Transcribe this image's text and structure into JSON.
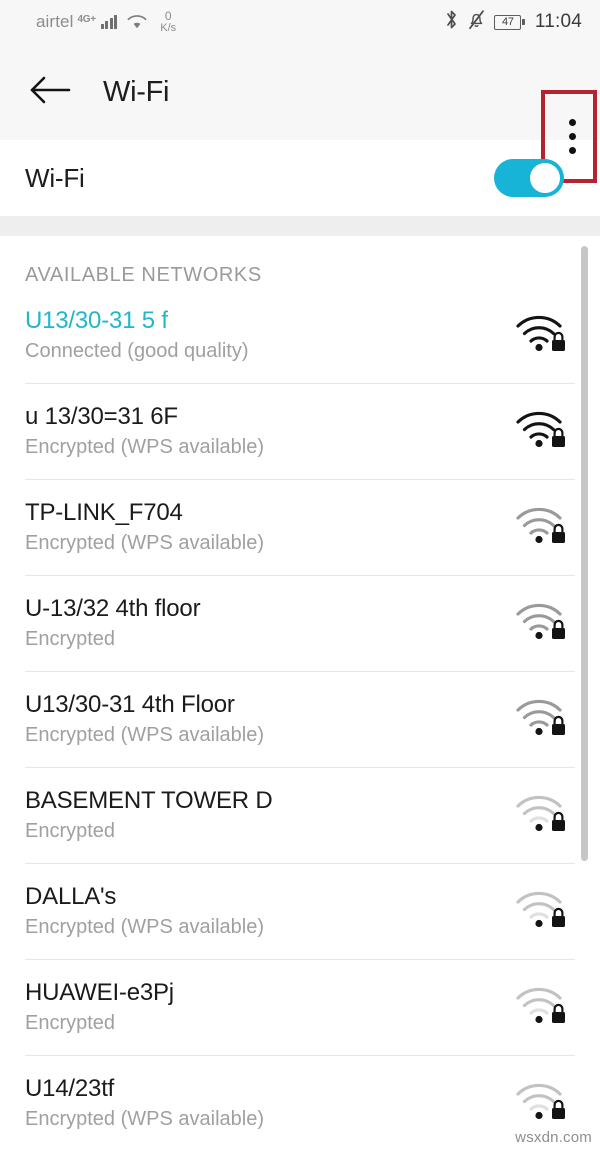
{
  "status_bar": {
    "carrier": "airtel",
    "network_type": "4G+",
    "data_rate_value": "0",
    "data_rate_unit": "K/s",
    "bluetooth_icon": "bluetooth-icon",
    "silent_icon": "bell-muted-icon",
    "battery_percent": "47",
    "time": "11:04"
  },
  "app_bar": {
    "back_icon": "back-arrow-icon",
    "title": "Wi-Fi",
    "overflow_icon": "overflow-menu-icon"
  },
  "wifi_toggle": {
    "label": "Wi-Fi",
    "state": "on",
    "accent_color": "#17b4d8"
  },
  "networks_section": {
    "header": "AVAILABLE NETWORKS",
    "items": [
      {
        "ssid": "U13/30-31 5 f",
        "status": "Connected (good quality)",
        "connected": true,
        "signal": 4,
        "secured": true
      },
      {
        "ssid": "u 13/30=31 6F",
        "status": "Encrypted (WPS available)",
        "connected": false,
        "signal": 4,
        "secured": true
      },
      {
        "ssid": "TP-LINK_F704",
        "status": "Encrypted (WPS available)",
        "connected": false,
        "signal": 3,
        "secured": true
      },
      {
        "ssid": "U-13/32 4th floor",
        "status": "Encrypted",
        "connected": false,
        "signal": 3,
        "secured": true
      },
      {
        "ssid": "U13/30-31 4th Floor",
        "status": "Encrypted (WPS available)",
        "connected": false,
        "signal": 3,
        "secured": true
      },
      {
        "ssid": "BASEMENT TOWER D",
        "status": "Encrypted",
        "connected": false,
        "signal": 2,
        "secured": true
      },
      {
        "ssid": "DALLA's",
        "status": "Encrypted (WPS available)",
        "connected": false,
        "signal": 2,
        "secured": true
      },
      {
        "ssid": "HUAWEI-e3Pj",
        "status": "Encrypted",
        "connected": false,
        "signal": 2,
        "secured": true
      },
      {
        "ssid": "U14/23tf",
        "status": "Encrypted (WPS available)",
        "connected": false,
        "signal": 2,
        "secured": true
      }
    ]
  },
  "annotation": {
    "color": "#b32430",
    "target": "overflow-menu-icon"
  },
  "watermark": "wsxdn.com"
}
